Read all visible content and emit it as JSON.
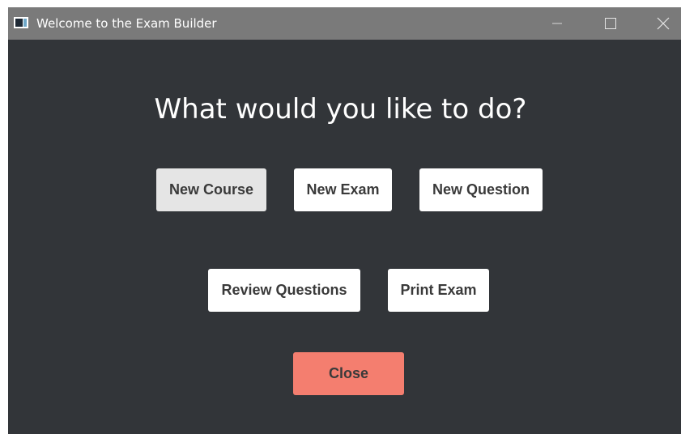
{
  "window": {
    "title": "Welcome to the Exam Builder",
    "icon": "app-window-icon",
    "controls": {
      "minimize_icon": "minimize-icon",
      "maximize_icon": "maximize-icon",
      "close_icon": "close-icon"
    }
  },
  "main": {
    "heading": "What would you like to do?",
    "buttons": {
      "new_course": "New Course",
      "new_exam": "New Exam",
      "new_question": "New Question",
      "review_questions": "Review Questions",
      "print_exam": "Print Exam",
      "close": "Close"
    },
    "selected_button": "New Course"
  },
  "colors": {
    "titlebar": "#7a7a7a",
    "background": "#323539",
    "button": "#ffffff",
    "button_selected": "#e5e5e5",
    "close_button": "#f47e6f",
    "button_text": "#3a3a3a"
  }
}
